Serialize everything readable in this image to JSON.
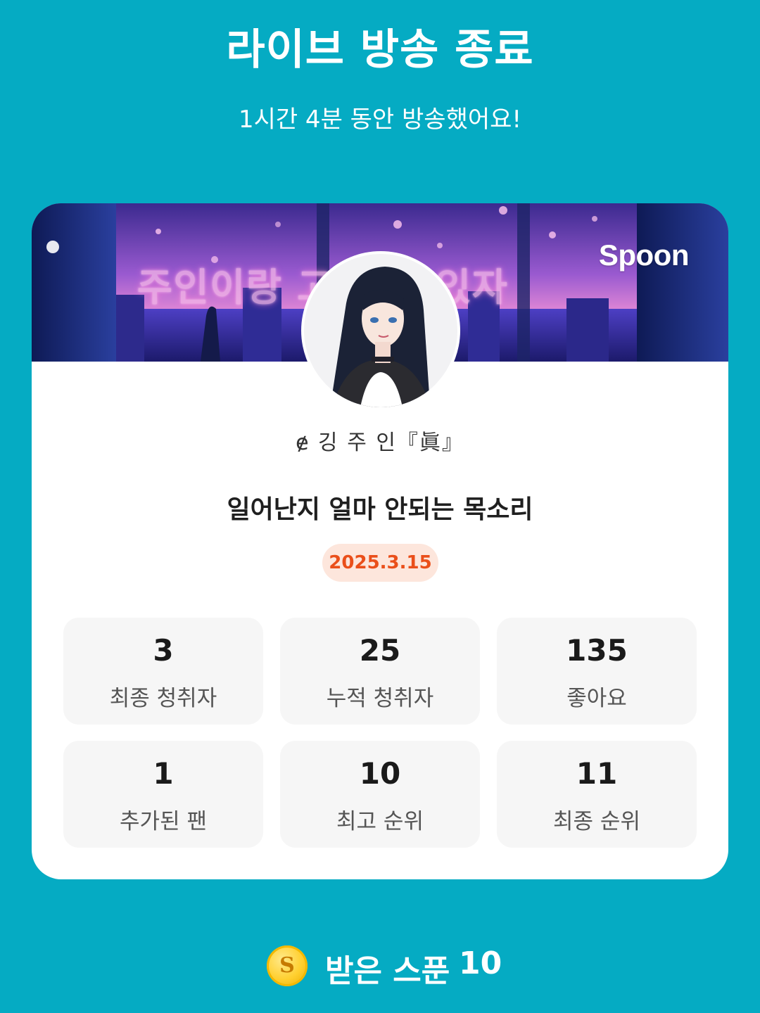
{
  "header": {
    "title": "라이브 방송 종료",
    "subtitle": "1시간 4분 동안 방송했어요!"
  },
  "card": {
    "banner_text": "주인이랑 고 같이 있자",
    "brand": "Spoon",
    "nickname": "ɇ 깅 주 인『眞』",
    "live_title": "일어난지 얼마 안되는 목소리",
    "date": "2025.3.15",
    "date_color": "#ea4f1a",
    "stats": [
      {
        "value": "3",
        "label": "최종 청취자"
      },
      {
        "value": "25",
        "label": "누적 청취자"
      },
      {
        "value": "135",
        "label": "좋아요"
      },
      {
        "value": "1",
        "label": "추가된 팬"
      },
      {
        "value": "10",
        "label": "최고 순위"
      },
      {
        "value": "11",
        "label": "최종 순위"
      }
    ]
  },
  "footer": {
    "coin_icon": "spoon-coin-icon",
    "coin_symbol": "S",
    "received_label": "받은 스푼",
    "received_value": "10"
  },
  "colors": {
    "background": "#05abc3",
    "card": "#ffffff",
    "stat_box": "#f6f6f6",
    "date_pill": "#fde6dc"
  }
}
